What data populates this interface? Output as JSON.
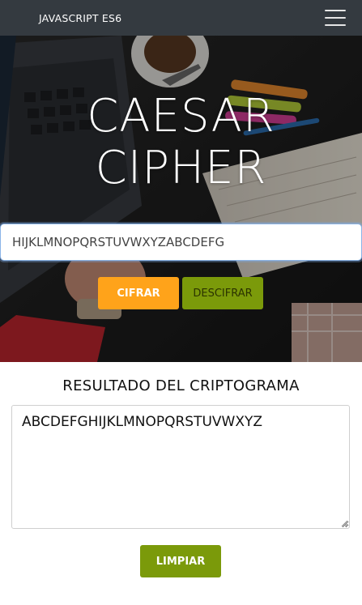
{
  "navbar": {
    "brand": "JAVASCRIPT ES6"
  },
  "hero": {
    "title_line1": "CAESAR",
    "title_line2": "CIPHER"
  },
  "cipher_input": {
    "value": "HIJKLMNOPQRSTUVWXYZABCDEFG"
  },
  "actions": {
    "cifrar": "CIFRAR",
    "descifrar": "DESCIFRAR"
  },
  "result": {
    "heading": "RESULTADO DEL CRIPTOGRAMA",
    "value": "ABCDEFGHIJKLMNOPQRSTUVWXYZ",
    "clear": "LIMPIAR"
  },
  "colors": {
    "navbar": "#343a40",
    "cifrar": "#ffa31a",
    "descifrar": "#7b9a0a",
    "limpiar": "#7b9a0a"
  },
  "icons": {
    "menu": "hamburger-menu-icon"
  }
}
